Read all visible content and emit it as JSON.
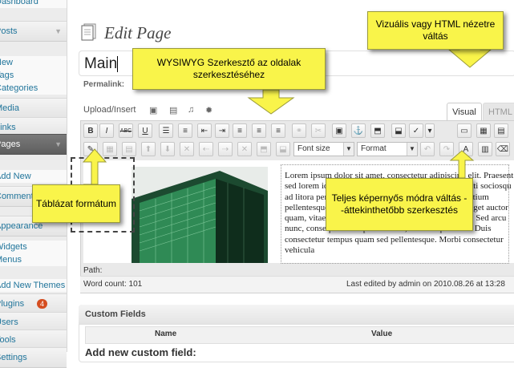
{
  "sidebar": {
    "items": [
      {
        "label": "Dashboard",
        "kind": "sub"
      },
      {
        "label": "Posts",
        "kind": "sec"
      },
      {
        "label": "New",
        "kind": "sub"
      },
      {
        "label": "Tags",
        "kind": "sub"
      },
      {
        "label": "Categories",
        "kind": "sub"
      },
      {
        "label": "Media",
        "kind": "sec"
      },
      {
        "label": "Links",
        "kind": "sec"
      },
      {
        "label": "Pages",
        "kind": "sec"
      },
      {
        "label": "Add New",
        "kind": "sub"
      },
      {
        "label": "Comments",
        "kind": "sec"
      },
      {
        "label": "Appearance",
        "kind": "sec"
      },
      {
        "label": "Widgets",
        "kind": "sub"
      },
      {
        "label": "Menus",
        "kind": "sub"
      },
      {
        "label": "Add New Themes",
        "kind": "sub"
      },
      {
        "label": "Plugins",
        "kind": "sec",
        "badge": "4"
      },
      {
        "label": "Users",
        "kind": "sec"
      },
      {
        "label": "Tools",
        "kind": "sec"
      },
      {
        "label": "Settings",
        "kind": "sec"
      }
    ]
  },
  "header": {
    "title": "Edit Page"
  },
  "title_input": {
    "value": "Main"
  },
  "permalink": {
    "label": "Permalink:"
  },
  "media": {
    "label": "Upload/Insert"
  },
  "tabs": {
    "visual": "Visual",
    "html": "HTML"
  },
  "toolbar": {
    "font_size": "Font size",
    "format": "Format",
    "row1_icons": [
      "bold-icon",
      "italic-icon",
      "strikethrough-icon",
      "underline-icon",
      "bullet-list-icon",
      "numbered-list-icon",
      "outdent-icon",
      "indent-icon",
      "align-left-icon",
      "align-center-icon",
      "align-right-icon",
      "link-icon",
      "unlink-icon",
      "insert-image-icon",
      "anchor-icon",
      "split-table-icon",
      "merge-table-icon",
      "spellcheck-icon",
      "fullscreen-icon",
      "kitchen-sink-icon",
      "media-icon"
    ],
    "row1_glyphs": [
      "B",
      "I",
      "ABC",
      "U",
      "☰",
      "≡",
      "⇤",
      "⇥",
      "≡",
      "≡",
      "≡",
      "⚭",
      "✂",
      "▣",
      "⚓",
      "⬒",
      "⬓",
      "✓",
      "▭",
      "▦",
      "▤"
    ]
  },
  "editor": {
    "lorem": "Lorem ipsum dolor sit amet, consectetur adipiscing elit. Praesent sed lorem id diam imperdiet in nibh. Class aptent taciti sociosqu ad litora per conubia nostra, per inceptos. Nullam pretium pellentesque. Etiam pellentesque mi non. Maecenas eget auctor quam, vitae erat non. ac placerat purus vulputate non. Sed arcu nunc, consequat vitae placerat sed, ultrices quis urna. Duis consectetur tempus quam sed pellentesque. Morbi consectetur vehicula",
    "path_label": "Path:",
    "word_count": "Word count: 101",
    "last_edited": "Last edited by admin on 2010.08.26 at 13:28"
  },
  "custom_fields": {
    "title": "Custom Fields",
    "col_name": "Name",
    "col_value": "Value",
    "add_label": "Add new custom field:"
  },
  "callouts": {
    "wysiwyg": "WYSIWYG Szerkesztő az oldalak szerkesztéséhez",
    "visual_html": "Vizuális vagy HTML nézetre váltás",
    "table": "Táblázat formátum",
    "fullscreen": "Teljes képernyős módra váltás - -áttekinthetőbb szerkesztés"
  },
  "colors": {
    "callout": "#f9f44a",
    "link": "#21759b",
    "active_menu": "#6a6a6a",
    "badge": "#d54e21"
  }
}
